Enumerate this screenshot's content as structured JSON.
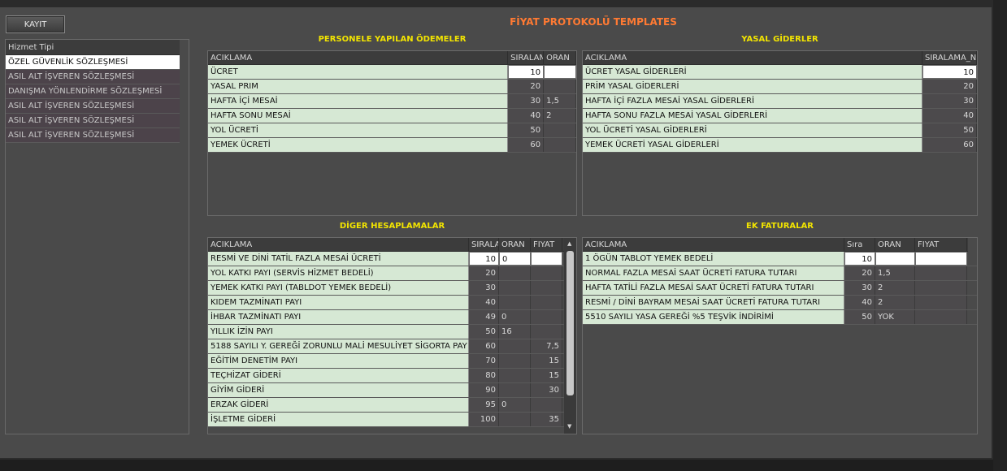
{
  "toolbar": {
    "save_label": "KAYIT"
  },
  "page_title": "FİYAT PROTOKOLÜ  TEMPLATES",
  "hizmet": {
    "header": "Hizmet Tipi",
    "items": [
      "ÖZEL GÜVENLİK SÖZLEŞMESİ",
      "ASIL ALT  İŞVEREN SÖZLEŞMESİ",
      "DANIŞMA YÖNLENDİRME SÖZLEŞMESİ",
      "ASIL ALT  İŞVEREN SÖZLEŞMESİ",
      "ASIL ALT  İŞVEREN SÖZLEŞMESİ",
      "ASIL ALT  İŞVEREN SÖZLEŞMESİ"
    ]
  },
  "personel": {
    "title": "PERSONELE YAPILAN ÖDEMELER",
    "headers": [
      "ACIKLAMA",
      "SIRALAM",
      "ORAN"
    ],
    "rows": [
      [
        "ÜCRET",
        "10",
        ""
      ],
      [
        "YASAL PRIM",
        "20",
        ""
      ],
      [
        "HAFTA İÇİ MESAİ",
        "30",
        "1,5"
      ],
      [
        "HAFTA SONU MESAİ",
        "40",
        "2"
      ],
      [
        "YOL ÜCRETİ",
        "50",
        ""
      ],
      [
        "YEMEK ÜCRETİ",
        "60",
        ""
      ]
    ]
  },
  "yasal": {
    "title": "YASAL GİDERLER",
    "headers": [
      "ACIKLAMA",
      "SIRALAMA_N"
    ],
    "rows": [
      [
        "ÜCRET YASAL GİDERLERİ",
        "10"
      ],
      [
        "PRİM YASAL GİDERLERİ",
        "20"
      ],
      [
        "HAFTA İÇİ FAZLA MESAİ YASAL GİDERLERİ",
        "30"
      ],
      [
        "HAFTA SONU FAZLA MESAİ YASAL GİDERLERİ",
        "40"
      ],
      [
        "YOL ÜCRETİ YASAL GİDERLERİ",
        "50"
      ],
      [
        "YEMEK ÜCRETİ YASAL GİDERLERİ",
        "60"
      ]
    ]
  },
  "diger": {
    "title": "DİGER HESAPLAMALAR",
    "headers": [
      "ACIKLAMA",
      "SIRALA",
      "ORAN",
      "FIYAT"
    ],
    "rows": [
      [
        "RESMİ VE DİNİ TATİL FAZLA MESAİ ÜCRETİ",
        "10",
        "0",
        ""
      ],
      [
        "YOL KATKI PAYI (SERVİS HİZMET BEDELİ)",
        "20",
        "",
        ""
      ],
      [
        "YEMEK KATKI PAYI (TABLDOT YEMEK BEDELİ)",
        "30",
        "",
        ""
      ],
      [
        "KIDEM TAZMİNATI PAYI",
        "40",
        "",
        ""
      ],
      [
        "İHBAR TAZMİNATI PAYI",
        "49",
        "0",
        ""
      ],
      [
        "YILLIK İZİN PAYI",
        "50",
        "16",
        ""
      ],
      [
        "5188 SAYILI Y. GEREĞİ ZORUNLU MALİ MESULİYET SİGORTA PAY",
        "60",
        "",
        "7,5"
      ],
      [
        "EĞİTİM DENETİM PAYI",
        "70",
        "",
        "15"
      ],
      [
        "TEÇHİZAT GİDERİ",
        "80",
        "",
        "15"
      ],
      [
        "GİYİM GİDERİ",
        "90",
        "",
        "30"
      ],
      [
        "ERZAK GİDERİ",
        "95",
        "0",
        ""
      ],
      [
        "İŞLETME GİDERİ",
        "100",
        "",
        "35"
      ]
    ]
  },
  "ek": {
    "title": "EK FATURALAR",
    "headers": [
      "ACIKLAMA",
      "Sıra",
      "ORAN",
      "FIYAT"
    ],
    "rows": [
      [
        "1 ÖGÜN TABLOT YEMEK BEDELİ",
        "10",
        "",
        ""
      ],
      [
        "NORMAL FAZLA MESAİ SAAT ÜCRETİ FATURA TUTARI",
        "20",
        "1,5",
        ""
      ],
      [
        "HAFTA TATİLİ FAZLA MESAİ SAAT ÜCRETİ FATURA TUTARI",
        "30",
        "2",
        ""
      ],
      [
        "RESMİ /  DİNİ BAYRAM MESAİ SAAT ÜCRETİ FATURA TUTARI",
        "40",
        "2",
        ""
      ],
      [
        "5510 SAYILI YASA GEREĞİ %5 TEŞVİK İNDİRİMİ",
        "50",
        "YOK",
        ""
      ]
    ]
  }
}
